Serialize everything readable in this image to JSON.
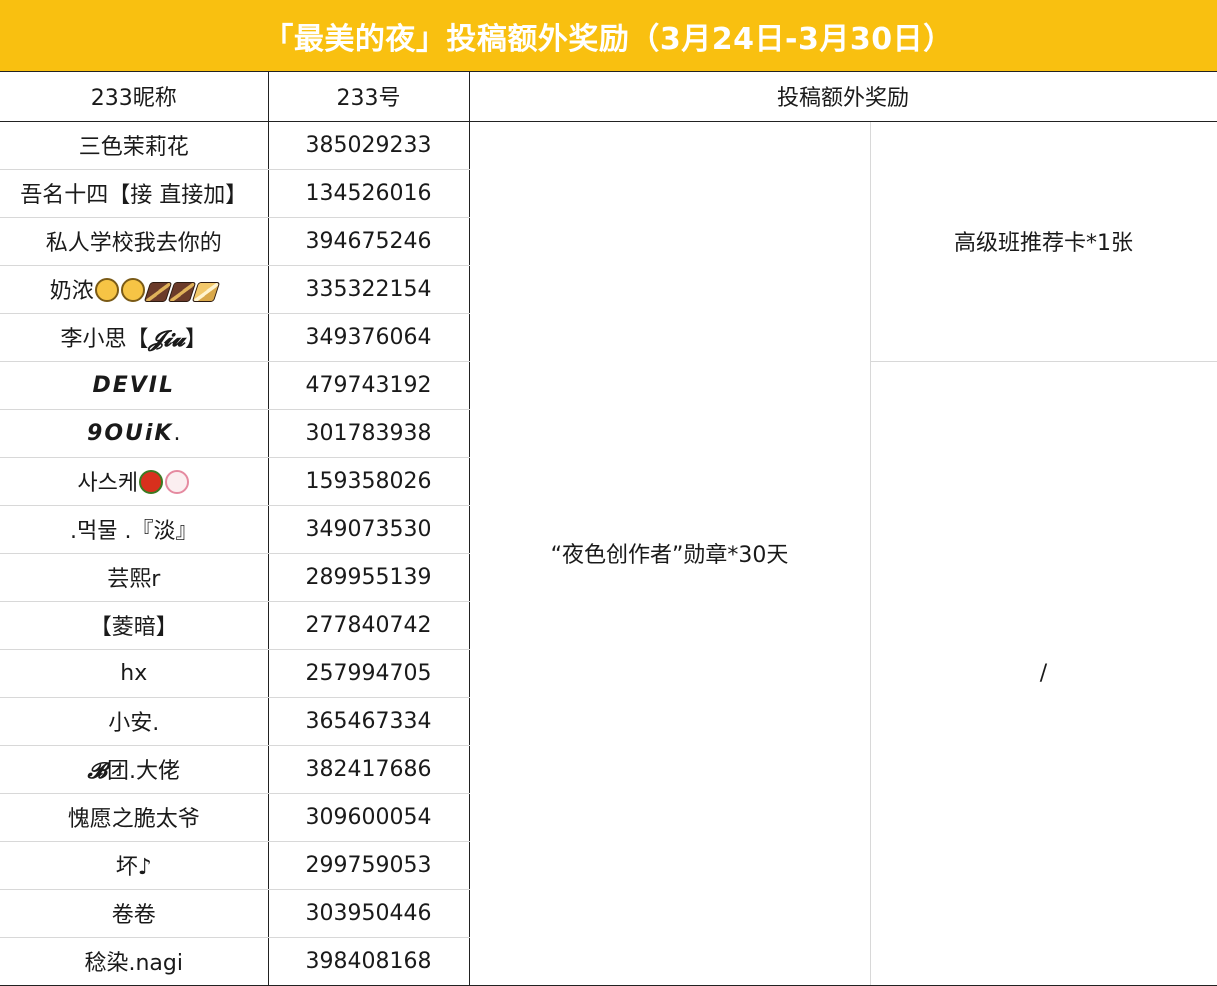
{
  "title": "「最美的夜」投稿额外奖励（3月24日-3月30日）",
  "headers": {
    "nickname": "233昵称",
    "uid": "233号",
    "reward": "投稿额外奖励"
  },
  "rows": [
    {
      "nickname": "三色茉莉花",
      "uid": "385029233"
    },
    {
      "nickname": "吾名十四【接 直接加】",
      "uid": "134526016"
    },
    {
      "nickname": "私人学校我去你的",
      "uid": "394675246"
    },
    {
      "nickname": "奶浓",
      "uid": "335322154"
    },
    {
      "nickname": "李小思【",
      "nickname_script": "𝓙𝓲𝓾",
      "nickname_end": "】",
      "uid": "349376064"
    },
    {
      "nickname": "DEVIL",
      "uid": "479743192"
    },
    {
      "nickname": "9OUiK",
      "nickname_end": ".",
      "uid": "301783938"
    },
    {
      "nickname": "사스케",
      "uid": "159358026"
    },
    {
      "nickname": ".먹물 .『淡』",
      "uid": "349073530"
    },
    {
      "nickname": "芸熙r",
      "uid": "289955139"
    },
    {
      "nickname": "【菱暗】",
      "uid": "277840742"
    },
    {
      "nickname": "hx",
      "uid": "257994705"
    },
    {
      "nickname": "小安.",
      "uid": "365467334"
    },
    {
      "nickname_script": "𝓑",
      "nickname": "团.大佬",
      "uid": "382417686"
    },
    {
      "nickname": "愧愿之脆太爷",
      "uid": "309600054"
    },
    {
      "nickname": "坏♪",
      "uid": "299759053"
    },
    {
      "nickname": "卷卷",
      "uid": "303950446"
    },
    {
      "nickname": "稔染.nagi",
      "uid": "398408168"
    }
  ],
  "rewards": {
    "medal": "“夜色创作者”勋章*30天",
    "top_group": "高级班推荐卡*1张",
    "bottom_group": "/"
  },
  "icons": {
    "row4": [
      "eye-roll-emoji-icon",
      "eye-roll-emoji-icon",
      "sandwich-emoji-icon",
      "sandwich-emoji-icon",
      "sandwich-emoji-icon"
    ],
    "row8": [
      "tomato-emoji-icon",
      "fish-cake-emoji-icon"
    ]
  },
  "colors": {
    "title_bg": "#f9c010",
    "title_text": "#ffffff"
  }
}
